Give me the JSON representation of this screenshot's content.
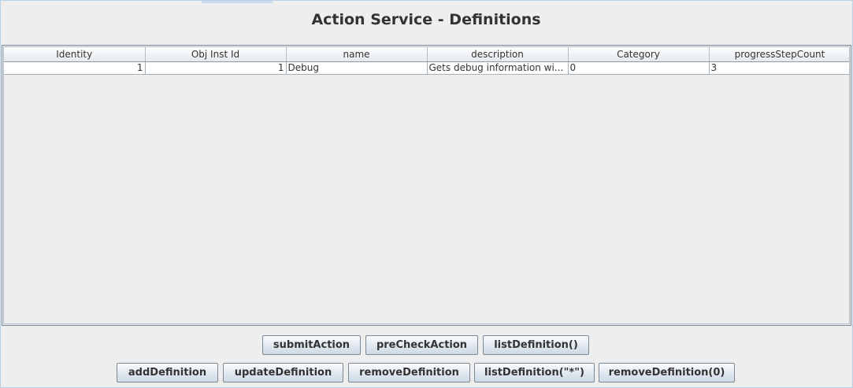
{
  "title": "Action Service - Definitions",
  "table": {
    "headers": [
      "Identity",
      "Obj Inst Id",
      "name",
      "description",
      "Category",
      "progressStepCount"
    ],
    "rows": [
      [
        "1",
        "1",
        "Debug",
        "Gets debug information wi...",
        "0",
        "3"
      ]
    ]
  },
  "buttons": {
    "row1": [
      "submitAction",
      "preCheckAction",
      "listDefinition()"
    ],
    "row2": [
      "addDefinition",
      "updateDefinition",
      "removeDefinition",
      "listDefinition(\"*\")",
      "removeDefinition(0)"
    ]
  },
  "colors": {
    "background": "#eeeeee",
    "frame_border": "#b8cfe5",
    "button_border": "#7a8a99"
  }
}
